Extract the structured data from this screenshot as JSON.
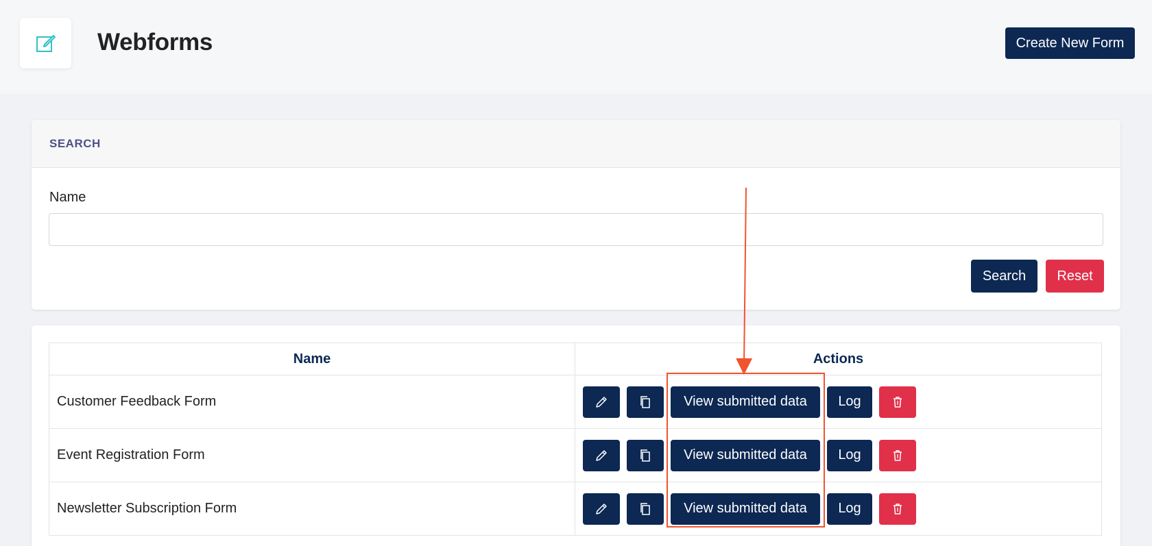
{
  "header": {
    "title": "Webforms",
    "create_label": "Create New Form",
    "logo_icon": "edit-form-icon"
  },
  "search": {
    "section_title": "SEARCH",
    "name_label": "Name",
    "name_value": "",
    "name_placeholder": "",
    "search_label": "Search",
    "reset_label": "Reset"
  },
  "table": {
    "columns": [
      "Name",
      "Actions"
    ],
    "rows": [
      {
        "name": "Customer Feedback Form",
        "view_label": "View submitted data",
        "log_label": "Log"
      },
      {
        "name": "Event Registration Form",
        "view_label": "View submitted data",
        "log_label": "Log"
      },
      {
        "name": "Newsletter Subscription Form",
        "view_label": "View submitted data",
        "log_label": "Log"
      }
    ]
  },
  "colors": {
    "navy": "#0c2853",
    "red": "#e1304a",
    "teal_icon": "#2fc1c9",
    "annotation": "#f0532d"
  }
}
